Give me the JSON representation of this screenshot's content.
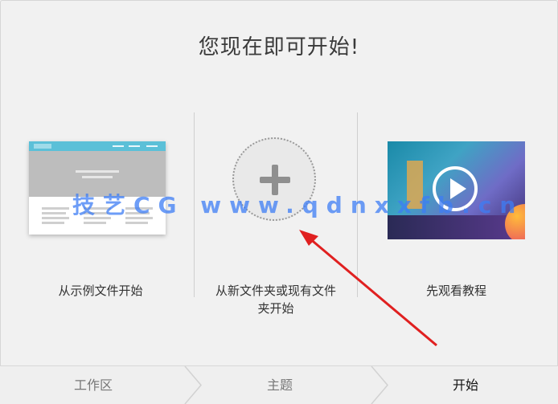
{
  "title": "您现在即可开始!",
  "options": {
    "sample": {
      "label": "从示例文件开始"
    },
    "folder": {
      "label_line1": "从新文件夹或现有文件",
      "label_line2": "夹开始"
    },
    "tutorial": {
      "label": "先观看教程"
    }
  },
  "watermark": "技艺CG  www.qdnxxfb.cn",
  "steps": [
    {
      "label": "工作区"
    },
    {
      "label": "主题"
    },
    {
      "label": "开始"
    }
  ],
  "colors": {
    "accent_arrow": "#e02020",
    "nav_bar": "#5bc0d8"
  },
  "icons": {
    "add": "plus-icon",
    "play": "play-icon"
  }
}
